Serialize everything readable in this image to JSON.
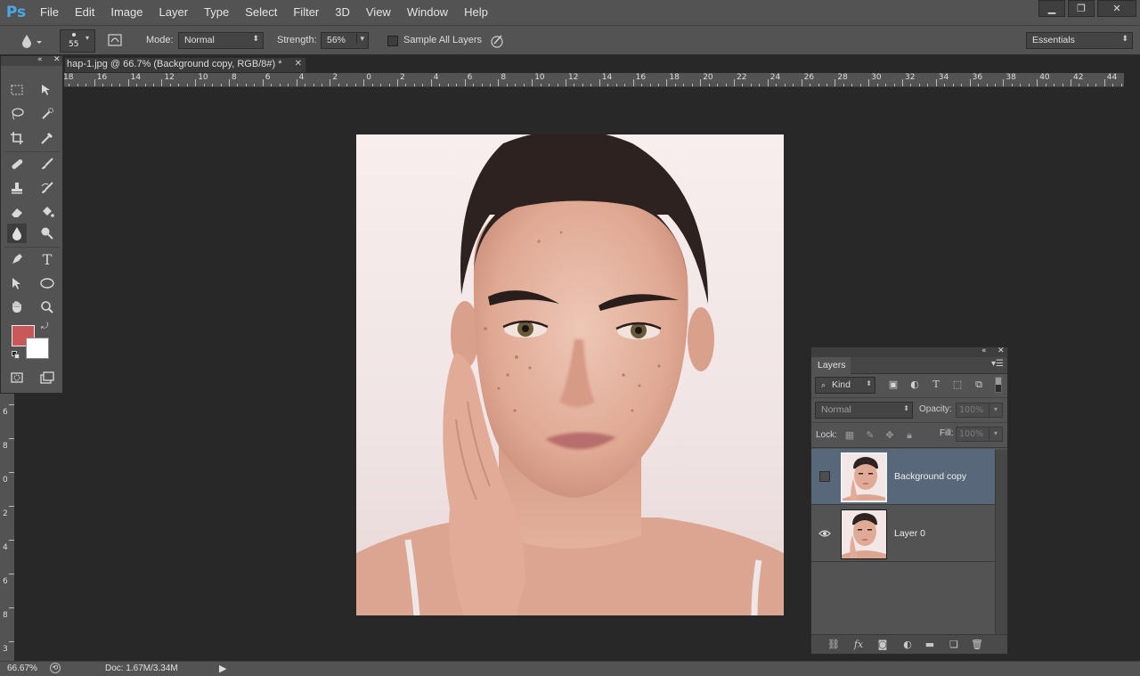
{
  "app": {
    "logo": "Ps"
  },
  "menu": [
    "File",
    "Edit",
    "Image",
    "Layer",
    "Type",
    "Select",
    "Filter",
    "3D",
    "View",
    "Window",
    "Help"
  ],
  "window_controls": {
    "minimize": "▁",
    "restore": "❐",
    "close": "✕"
  },
  "options": {
    "brush_size": "55",
    "mode_label": "Mode:",
    "mode_value": "Normal",
    "strength_label": "Strength:",
    "strength_value": "56%",
    "sample_all_layers": "Sample All Layers",
    "workspace": "Essentials"
  },
  "document_tab": {
    "title": "hap-1.jpg @ 66.7% (Background copy, RGB/8#) *",
    "close": "✕"
  },
  "ruler": {
    "h_labels": [
      "18",
      "16",
      "14",
      "12",
      "10",
      "8",
      "6",
      "4",
      "2",
      "0",
      "2",
      "4",
      "6",
      "8",
      "10",
      "12",
      "14",
      "16",
      "18",
      "20",
      "22",
      "24",
      "26",
      "28",
      "30",
      "32",
      "34",
      "36",
      "38",
      "40",
      "42",
      "44"
    ],
    "v_labels": [
      "6",
      "8",
      "0",
      "2",
      "4",
      "6",
      "8",
      "3"
    ]
  },
  "tools": {
    "colors": {
      "foreground": "#c9585b",
      "background": "#ffffff"
    },
    "icons": [
      "marquee-icon",
      "move-icon",
      "lasso-icon",
      "quick-select-icon",
      "crop-icon",
      "eyedropper-icon",
      "healing-brush-icon",
      "brush-icon",
      "clone-stamp-icon",
      "history-brush-icon",
      "eraser-icon",
      "paint-bucket-icon",
      "blur-icon",
      "dodge-icon",
      "pen-icon",
      "type-icon",
      "path-select-icon",
      "ellipse-icon",
      "hand-icon",
      "zoom-icon"
    ]
  },
  "layers_panel": {
    "tab": "Layers",
    "filter_kind": "Kind",
    "blend_mode": "Normal",
    "opacity_label": "Opacity:",
    "opacity_value": "100%",
    "lock_label": "Lock:",
    "fill_label": "Fill:",
    "fill_value": "100%",
    "layers": [
      {
        "name": "Background copy",
        "visible": false,
        "selected": true
      },
      {
        "name": "Layer 0",
        "visible": true,
        "selected": false
      }
    ]
  },
  "status": {
    "zoom": "66.67%",
    "doc": "Doc: 1.67M/3.34M"
  }
}
